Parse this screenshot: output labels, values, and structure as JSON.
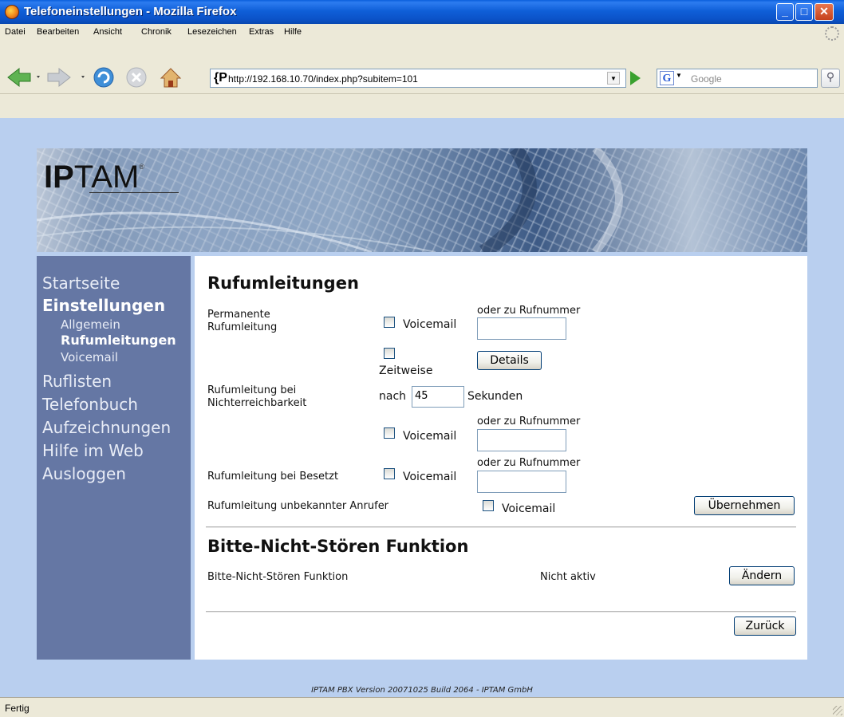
{
  "window": {
    "title": "Telefoneinstellungen - Mozilla Firefox",
    "min_label": "_",
    "max_label": "□",
    "close_label": "✕"
  },
  "menu": {
    "items": [
      {
        "label": "Datei"
      },
      {
        "label": "Bearbeiten"
      },
      {
        "label": "Ansicht"
      },
      {
        "label": "Chronik"
      },
      {
        "label": "Lesezeichen"
      },
      {
        "label": "Extras"
      },
      {
        "label": "Hilfe"
      }
    ]
  },
  "toolbar": {
    "url": "http://192.168.10.70/index.php?subitem=101",
    "site_icon": "{P",
    "search_placeholder": "Google",
    "search_engine_icon": "G",
    "icons": [
      "back-icon",
      "forward-icon",
      "reload-icon",
      "stop-icon",
      "home-icon",
      "go-icon",
      "search-icon"
    ]
  },
  "logo": {
    "text_bold": "IP",
    "text_regular": "TAM",
    "registered": "®"
  },
  "sidebar": {
    "items": [
      {
        "label": "Startseite"
      },
      {
        "label": "Einstellungen"
      },
      {
        "label": "Allgemein"
      },
      {
        "label": "Rufumleitungen"
      },
      {
        "label": "Voicemail"
      },
      {
        "label": "Ruflisten"
      },
      {
        "label": "Telefonbuch"
      },
      {
        "label": "Aufzeichnungen"
      },
      {
        "label": "Hilfe im Web"
      },
      {
        "label": "Ausloggen"
      }
    ]
  },
  "rufumleitungen": {
    "heading": "Rufumleitungen",
    "permanent_label_line1": "Permanente",
    "permanent_label_line2": "Rufumleitung",
    "voicemail": "Voicemail",
    "oder_zu_rufnummer": "oder zu Rufnummer",
    "zeitweise": "Zeitweise",
    "details_button": "Details",
    "nichterreichbar_line1": "Rufumleitung bei",
    "nichterreichbar_line2": "Nichterreichbarkeit",
    "nach": "nach",
    "seconds_value": "45",
    "sekunden": "Sekunden",
    "besetzt_label": "Rufumleitung bei Besetzt",
    "unbekannt_label": "Rufumleitung unbekannter Anrufer",
    "apply_button": "Übernehmen"
  },
  "dnd": {
    "heading": "Bitte-Nicht-Stören Funktion",
    "label": "Bitte-Nicht-Stören Funktion",
    "status": "Nicht aktiv",
    "change_button": "Ändern"
  },
  "back_button": "Zurück",
  "footer": "IPTAM PBX Version 20071025 Build 2064 - IPTAM GmbH",
  "status": "Fertig"
}
